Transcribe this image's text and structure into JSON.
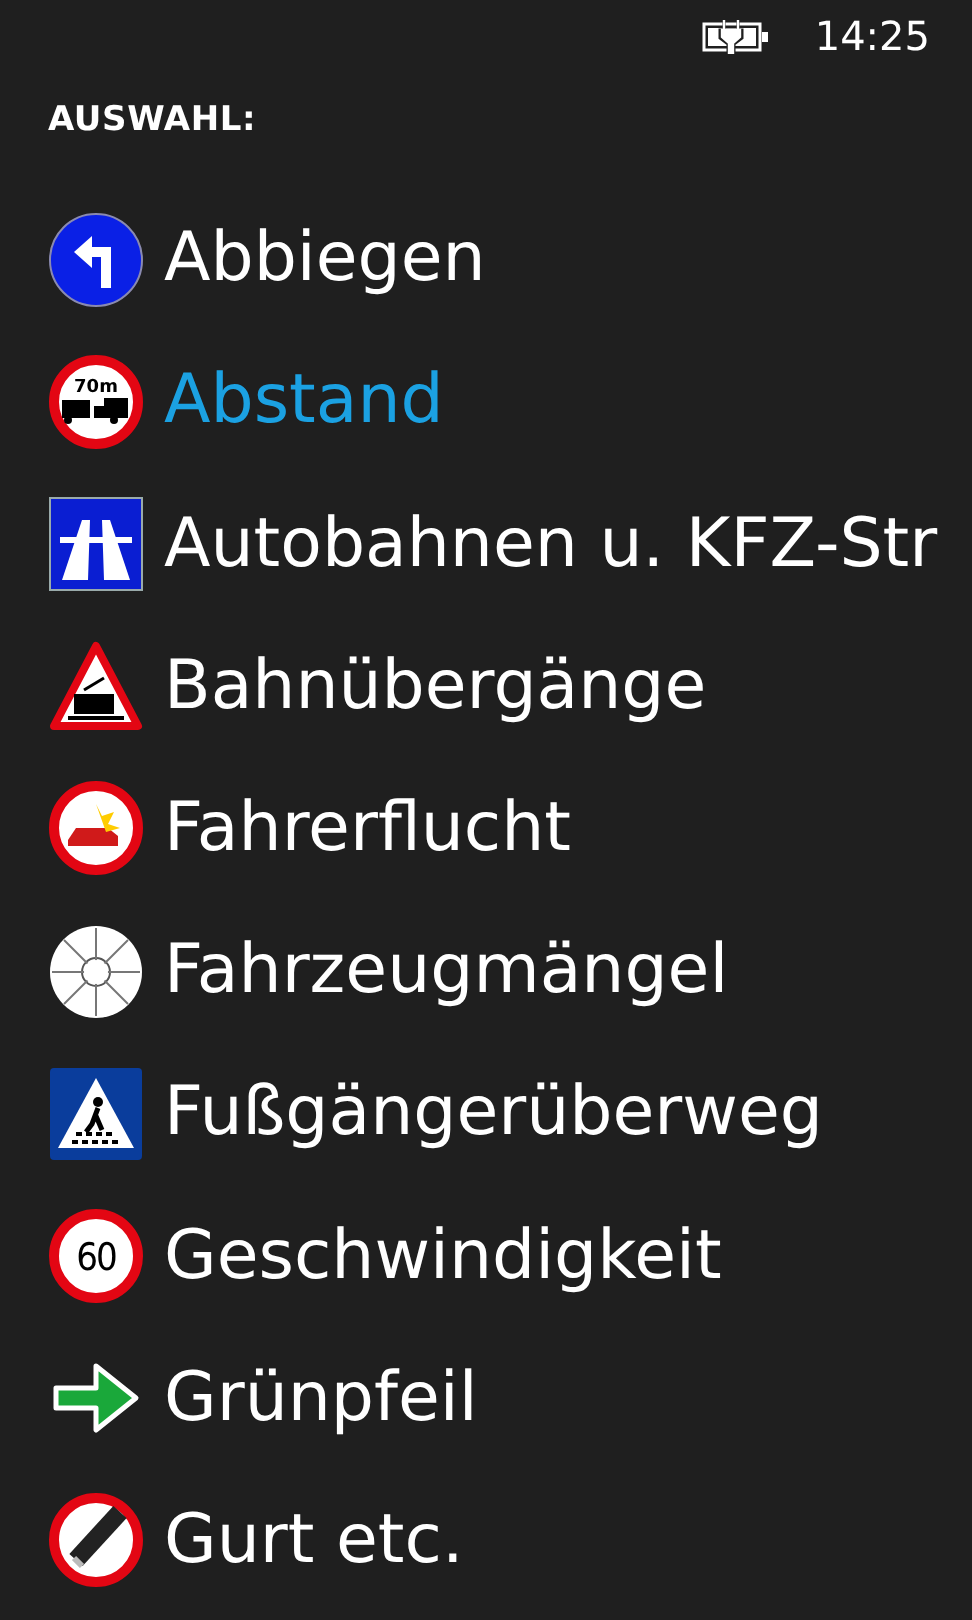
{
  "status_bar": {
    "time": "14:25"
  },
  "header": "AUSWAHL:",
  "items": [
    {
      "label": "Abbiegen",
      "kind": "turn",
      "selected": false
    },
    {
      "label": "Abstand",
      "kind": "distance",
      "sign_text": "70m",
      "selected": true
    },
    {
      "label": "Autobahnen u. KFZ-Str",
      "kind": "motorway",
      "selected": false
    },
    {
      "label": "Bahnübergänge",
      "kind": "railway",
      "selected": false
    },
    {
      "label": "Fahrerflucht",
      "kind": "crash",
      "selected": false
    },
    {
      "label": "Fahrzeugmängel",
      "kind": "inspection",
      "selected": false
    },
    {
      "label": "Fußgängerüberweg",
      "kind": "crosswalk",
      "selected": false
    },
    {
      "label": "Geschwindigkeit",
      "kind": "speed",
      "sign_text": "60",
      "selected": false
    },
    {
      "label": "Grünpfeil",
      "kind": "arrow",
      "selected": false
    },
    {
      "label": "Gurt etc.",
      "kind": "belt",
      "selected": false
    }
  ]
}
